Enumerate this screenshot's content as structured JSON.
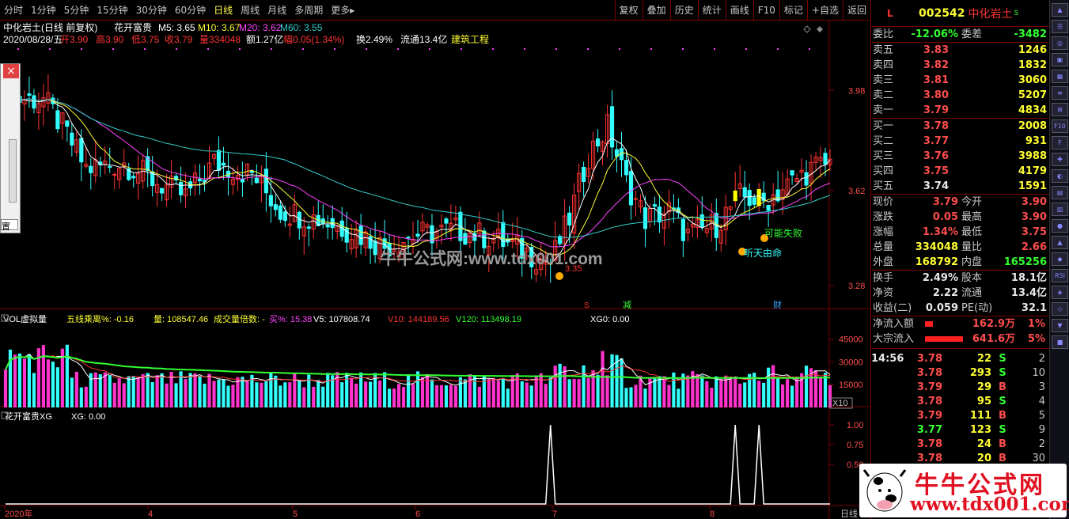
{
  "toolbar": {
    "periods": [
      "分时",
      "1分钟",
      "5分钟",
      "15分钟",
      "30分钟",
      "60分钟",
      "日线",
      "周线",
      "月线",
      "多周期",
      "更多▸"
    ],
    "active": "日线",
    "right": [
      "复权",
      "叠加",
      "历史",
      "统计",
      "画线",
      "F10",
      "标记",
      "+自选",
      "返回"
    ]
  },
  "header": {
    "line1": {
      "name": "中化岩土(日线 前复权)",
      "formula": "花开富贵",
      "ma5": "M5: 3.65",
      "ma10": "M10: 3.67",
      "ma20": "M20: 3.62",
      "ma60": "M60: 3.55"
    },
    "line2": {
      "date": "2020/08/28/五",
      "open": "开3.90",
      "high": "高3.90",
      "low": "低3.75",
      "close": "收3.79",
      "vol": "量334048",
      "amt": "额1.27亿",
      "amp": "幅0.05(1.34%)",
      "turn": "换2.49%",
      "float": "流通13.4亿",
      "industry": "建筑工程"
    }
  },
  "price_axis": [
    "3.98",
    "3.62",
    "3.28"
  ],
  "annotations": {
    "low_label": "3.35",
    "fail_label": "可能失败",
    "fate_label": "听天由命",
    "mark_s": "S",
    "mark_jian": "减",
    "mark_cai": "财"
  },
  "watermark": "牛牛公式网:www.tdx001.com",
  "vol_header": {
    "title": "VOL虚拟量",
    "wx": "五线乘离%: -0.16",
    "liang": "量: 108547.46",
    "beishu": "成交量倍数: -",
    "mai": "买%: 15.38",
    "v5": "V5: 107808.74",
    "v10": "V10: 144189.56",
    "v120": "V120: 113498.19",
    "xg": "XG0: 0.00"
  },
  "vol_axis": [
    "45000",
    "30000",
    "15000"
  ],
  "vol_unit": "X10",
  "ind_header": {
    "title": "花开富贵XG",
    "xg": "XG: 0.00"
  },
  "ind_axis": [
    "1.00",
    "0.75",
    "0.50"
  ],
  "date_axis": [
    "2020年",
    "4",
    "5",
    "6",
    "7",
    "8"
  ],
  "period_label": "日线",
  "chart_data": {
    "type": "candlestick",
    "ohlc_series_note": "",
    "price_range": [
      3.22,
      4.12
    ],
    "ma_lines": [
      "M5",
      "M10",
      "M20",
      "M60"
    ],
    "xg_signals": [
      0,
      0,
      0,
      0,
      0,
      0,
      0,
      0,
      0,
      0,
      0,
      0,
      0,
      0,
      0,
      0,
      0,
      0,
      0,
      0,
      0,
      0,
      0,
      0,
      0,
      0,
      0,
      0,
      0,
      0,
      0,
      0,
      0,
      0,
      0,
      0,
      0,
      0,
      0,
      0,
      0,
      0,
      0,
      0,
      0,
      0,
      0,
      0,
      0,
      0,
      0,
      0,
      0,
      0,
      0,
      0,
      0,
      0,
      0,
      0,
      0,
      0,
      0,
      0,
      0,
      0,
      0,
      0,
      0,
      0,
      0,
      0,
      0,
      0,
      0,
      0,
      0,
      0,
      0,
      0,
      0,
      0,
      0,
      0,
      0,
      0,
      0,
      0,
      0,
      0,
      0,
      0,
      0,
      0,
      0,
      0,
      0,
      0,
      0,
      0,
      0,
      0,
      0,
      0,
      0,
      0,
      0,
      0,
      0,
      0,
      0,
      0,
      0,
      0,
      0,
      1,
      0,
      0,
      0,
      0,
      0,
      0,
      0,
      0,
      0,
      0,
      0,
      0,
      0,
      0,
      0,
      0,
      0,
      0,
      0,
      0,
      0,
      0,
      0,
      0,
      0,
      0,
      0,
      0,
      0,
      0,
      0,
      0,
      0,
      0,
      0,
      0,
      0,
      0,
      1,
      0,
      0,
      0,
      0,
      1,
      0,
      0,
      0,
      0,
      0,
      0,
      0,
      0,
      0,
      0,
      0,
      0,
      0,
      0,
      0
    ]
  },
  "quote": {
    "tag": "L",
    "code": "002542",
    "name": "中化岩土",
    "flag": "S",
    "weibi": {
      "label": "委比",
      "value": "-12.06%",
      "label2": "委差",
      "value2": "-3482"
    },
    "asks": [
      {
        "l": "卖五",
        "p": "3.83",
        "v": "1246"
      },
      {
        "l": "卖四",
        "p": "3.82",
        "v": "1832"
      },
      {
        "l": "卖三",
        "p": "3.81",
        "v": "3060"
      },
      {
        "l": "卖二",
        "p": "3.80",
        "v": "5207"
      },
      {
        "l": "卖一",
        "p": "3.79",
        "v": "4834"
      }
    ],
    "bids": [
      {
        "l": "买一",
        "p": "3.78",
        "v": "2008"
      },
      {
        "l": "买二",
        "p": "3.77",
        "v": "931"
      },
      {
        "l": "买三",
        "p": "3.76",
        "v": "3988"
      },
      {
        "l": "买四",
        "p": "3.75",
        "v": "4179"
      },
      {
        "l": "买五",
        "p": "3.74",
        "v": "1591"
      }
    ],
    "stats": [
      {
        "a": "现价",
        "b": "3.79",
        "c": "今开",
        "d": "3.90"
      },
      {
        "a": "涨跌",
        "b": "0.05",
        "c": "最高",
        "d": "3.90"
      },
      {
        "a": "涨幅",
        "b": "1.34%",
        "c": "最低",
        "d": "3.75"
      },
      {
        "a": "总量",
        "b": "334048",
        "c": "量比",
        "d": "2.66"
      },
      {
        "a": "外盘",
        "b": "168792",
        "c": "内盘",
        "d": "165256"
      }
    ],
    "stats2": [
      {
        "a": "换手",
        "b": "2.49%",
        "c": "股本",
        "d": "18.1亿"
      },
      {
        "a": "净资",
        "b": "2.22",
        "c": "流通",
        "d": "13.4亿"
      },
      {
        "a": "收益(二)",
        "b": "0.059",
        "c": "PE(动)",
        "d": "32.1"
      }
    ],
    "flow": [
      {
        "l": "净流入额",
        "v": "162.9万",
        "p": "1%"
      },
      {
        "l": "大宗流入",
        "v": "641.6万",
        "p": "5%"
      }
    ],
    "ticks": [
      {
        "t": "14:56",
        "p": "3.78",
        "v": "22",
        "f": "S",
        "n": "2"
      },
      {
        "t": "",
        "p": "3.78",
        "v": "293",
        "f": "S",
        "n": "10"
      },
      {
        "t": "",
        "p": "3.79",
        "v": "29",
        "f": "B",
        "n": "3"
      },
      {
        "t": "",
        "p": "3.78",
        "v": "95",
        "f": "S",
        "n": "4"
      },
      {
        "t": "",
        "p": "3.79",
        "v": "111",
        "f": "B",
        "n": "5"
      },
      {
        "t": "",
        "p": "3.77",
        "v": "123",
        "f": "S",
        "n": "9"
      },
      {
        "t": "",
        "p": "3.78",
        "v": "24",
        "f": "B",
        "n": "2"
      },
      {
        "t": "",
        "p": "3.78",
        "v": "20",
        "f": "B",
        "n": "30"
      }
    ]
  },
  "logo": {
    "line1": "牛牛公式网",
    "line2": "www.tdx001.com"
  },
  "popup": {
    "close": "×",
    "label": "置"
  },
  "sidebar": [
    "▲",
    "☰",
    "◎",
    "▣",
    "▦",
    "≡",
    "⊞",
    "F10",
    "F",
    "✚",
    "◐",
    "▤",
    "▥",
    "●",
    "▲",
    "◆",
    "RSI",
    "◈",
    "◇",
    "▼",
    "■"
  ],
  "colors": {
    "up": "#ff3333",
    "down": "#33ffff",
    "ma5": "#ffffff",
    "ma10": "#ffff33",
    "ma20": "#ff44ff",
    "ma60": "#33cccc"
  }
}
